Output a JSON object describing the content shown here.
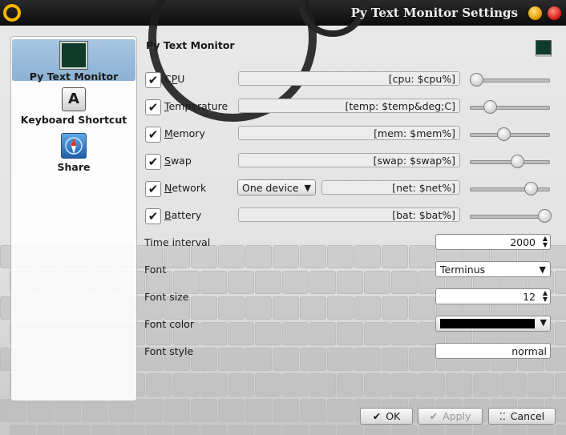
{
  "window": {
    "title": "Py Text Monitor Settings",
    "icon": "app-swirl-icon"
  },
  "sidebar": {
    "items": [
      {
        "label": "Py Text Monitor",
        "icon": "monitor-icon",
        "selected": true
      },
      {
        "label": "Keyboard Shortcut",
        "icon": "keyboard-key-icon",
        "icon_glyph": "A",
        "selected": false
      },
      {
        "label": "Share",
        "icon": "share-compass-icon",
        "selected": false
      }
    ]
  },
  "panel": {
    "title": "Py Text Monitor",
    "icon": "monitor-icon"
  },
  "monitors": [
    {
      "label": "CPU",
      "mnemonic_index": 1,
      "checked": true,
      "format": "[cpu: $cpu%]",
      "slider_level": 0.0
    },
    {
      "label": "Temperature",
      "mnemonic_index": 0,
      "checked": true,
      "format": "[temp: $temp&deg;C]",
      "slider_level": 0.2
    },
    {
      "label": "Memory",
      "mnemonic_index": 0,
      "checked": true,
      "format": "[mem: $mem%]",
      "slider_level": 0.4
    },
    {
      "label": "Swap",
      "mnemonic_index": 0,
      "checked": true,
      "format": "[swap: $swap%]",
      "slider_level": 0.6
    },
    {
      "label": "Network",
      "mnemonic_index": 0,
      "checked": true,
      "format": "[net: $net%]",
      "slider_level": 0.8,
      "device_option": "One device"
    },
    {
      "label": "Battery",
      "mnemonic_index": 0,
      "checked": true,
      "format": "[bat: $bat%]",
      "slider_level": 1.0
    }
  ],
  "settings": {
    "time_interval": {
      "label": "Time interval",
      "value": "2000"
    },
    "font": {
      "label": "Font",
      "value": "Terminus"
    },
    "font_size": {
      "label": "Font size",
      "value": "12"
    },
    "font_color": {
      "label": "Font color",
      "value": "#000000"
    },
    "font_style": {
      "label": "Font style",
      "value": "normal"
    }
  },
  "buttons": {
    "ok": {
      "label": "OK",
      "icon": "checkmark-icon"
    },
    "apply": {
      "label": "Apply",
      "icon": "checkmark-icon",
      "disabled": true
    },
    "cancel": {
      "label": "Cancel",
      "icon": "cancel-dots-icon"
    }
  },
  "colors": {
    "selection": "#9dbddb",
    "titlebar": "#161616",
    "minimize": "#f0b000",
    "close": "#d8201a"
  }
}
